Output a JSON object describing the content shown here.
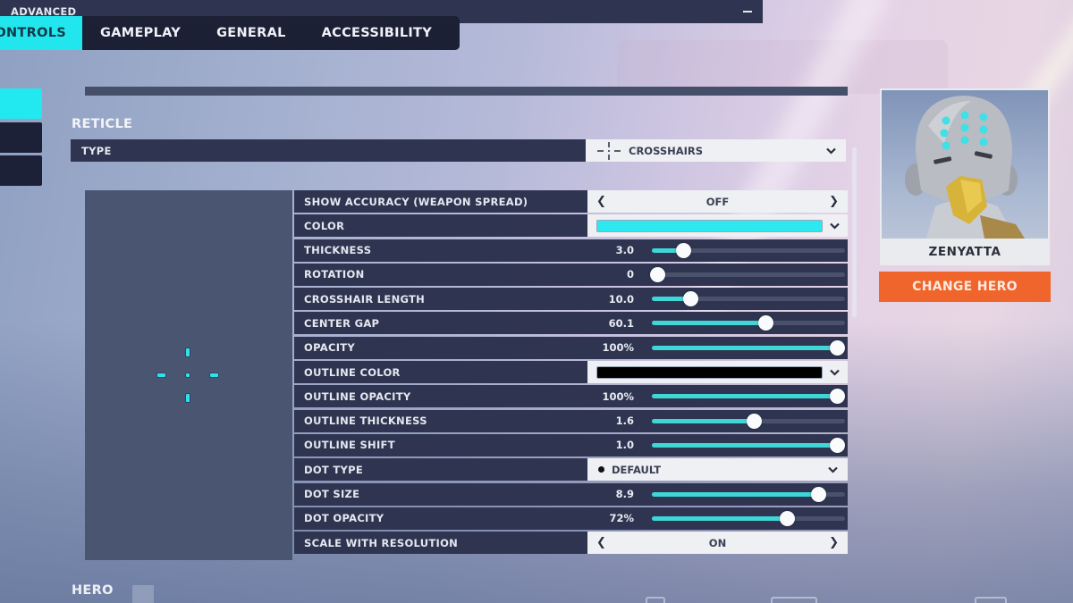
{
  "tabs": [
    {
      "label": "CONTROLS",
      "active": true
    },
    {
      "label": "GAMEPLAY",
      "active": false
    },
    {
      "label": "GENERAL",
      "active": false
    },
    {
      "label": "ACCESSIBILITY",
      "active": false
    }
  ],
  "section": {
    "title": "RETICLE",
    "next_title": "HERO"
  },
  "type_row": {
    "label": "TYPE",
    "value": "CROSSHAIRS",
    "icon": "crosshair-icon"
  },
  "advanced": {
    "label": "ADVANCED",
    "toggle_icon": "collapse-minus-icon"
  },
  "settings": [
    {
      "label": "SHOW ACCURACY (WEAPON SPREAD)",
      "kind": "selector",
      "value": "OFF"
    },
    {
      "label": "COLOR",
      "kind": "color",
      "value": "#2ee8f0"
    },
    {
      "label": "THICKNESS",
      "kind": "slider",
      "value": "3.0",
      "fraction": 0.16
    },
    {
      "label": "ROTATION",
      "kind": "slider",
      "value": "0",
      "fraction": 0.03
    },
    {
      "label": "CROSSHAIR LENGTH",
      "kind": "slider",
      "value": "10.0",
      "fraction": 0.2
    },
    {
      "label": "CENTER GAP",
      "kind": "slider",
      "value": "60.1",
      "fraction": 0.59
    },
    {
      "label": "OPACITY",
      "kind": "slider",
      "value": "100%",
      "fraction": 0.96
    },
    {
      "label": "OUTLINE COLOR",
      "kind": "color",
      "value": "#000000"
    },
    {
      "label": "OUTLINE OPACITY",
      "kind": "slider",
      "value": "100%",
      "fraction": 0.96
    },
    {
      "label": "OUTLINE THICKNESS",
      "kind": "slider",
      "value": "1.6",
      "fraction": 0.53
    },
    {
      "label": "OUTLINE SHIFT",
      "kind": "slider",
      "value": "1.0",
      "fraction": 0.96
    },
    {
      "label": "DOT TYPE",
      "kind": "dropdown",
      "value": "DEFAULT"
    },
    {
      "label": "DOT SIZE",
      "kind": "slider",
      "value": "8.9",
      "fraction": 0.86
    },
    {
      "label": "DOT OPACITY",
      "kind": "slider",
      "value": "72%",
      "fraction": 0.7
    },
    {
      "label": "SCALE WITH RESOLUTION",
      "kind": "selector",
      "value": "ON"
    }
  ],
  "hero": {
    "name": "ZENYATTA",
    "change_label": "CHANGE HERO"
  },
  "colors": {
    "accent": "#22e6ee",
    "slider_fill": "#3fd6d6",
    "change_hero": "#f0652b",
    "panel": "#2f3550"
  }
}
